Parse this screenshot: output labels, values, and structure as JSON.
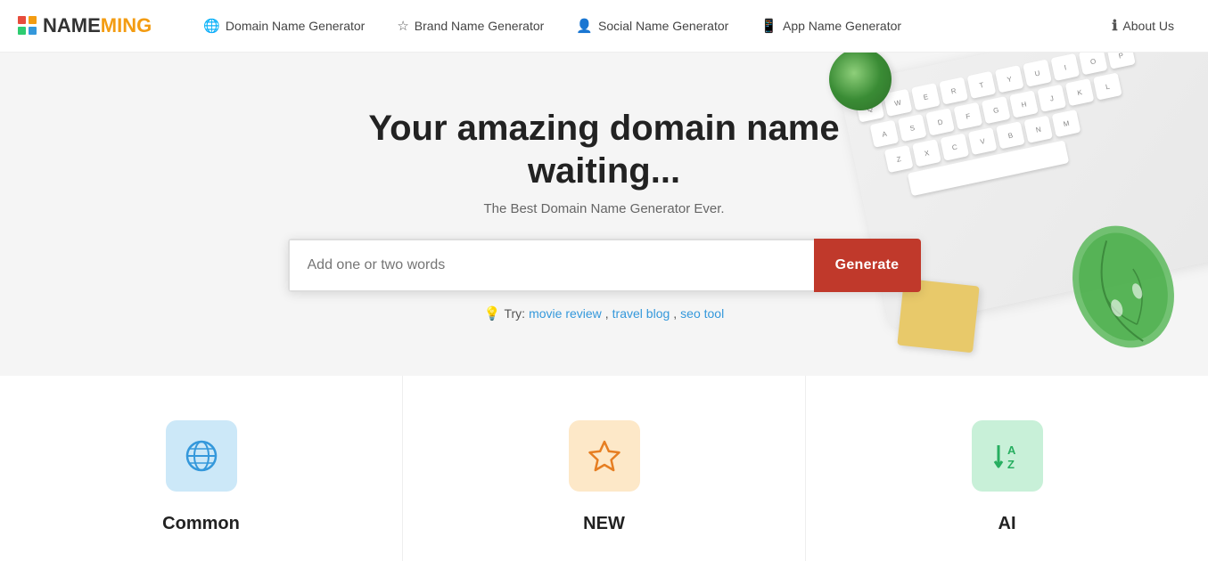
{
  "header": {
    "logo": {
      "name": "NAME",
      "highlight": "MING"
    },
    "nav": [
      {
        "id": "domain",
        "icon": "🌐",
        "label": "Domain Name Generator"
      },
      {
        "id": "brand",
        "icon": "⭐",
        "label": "Brand Name Generator"
      },
      {
        "id": "social",
        "icon": "👤",
        "label": "Social Name Generator"
      },
      {
        "id": "app",
        "icon": "📱",
        "label": "App Name Generator"
      }
    ],
    "about": {
      "icon": "ℹ",
      "label": "About Us"
    }
  },
  "hero": {
    "title": "Your amazing domain name waiting...",
    "subtitle": "The Best Domain Name Generator Ever.",
    "search_placeholder": "Add one or two words",
    "generate_label": "Generate",
    "try_label": "Try:",
    "try_links": [
      "movie review",
      "travel blog",
      "seo tool"
    ]
  },
  "cards": [
    {
      "id": "common",
      "icon": "🌐",
      "icon_color": "blue",
      "label": "Common"
    },
    {
      "id": "new",
      "icon": "⭐",
      "icon_color": "orange",
      "label": "NEW"
    },
    {
      "id": "ai",
      "icon": "🔤",
      "icon_color": "green",
      "label": "AI"
    }
  ],
  "colors": {
    "logo_highlight": "#f39c12",
    "generate_btn": "#c0392b",
    "try_link": "#3498db",
    "try_icon": "#2ecc71"
  }
}
